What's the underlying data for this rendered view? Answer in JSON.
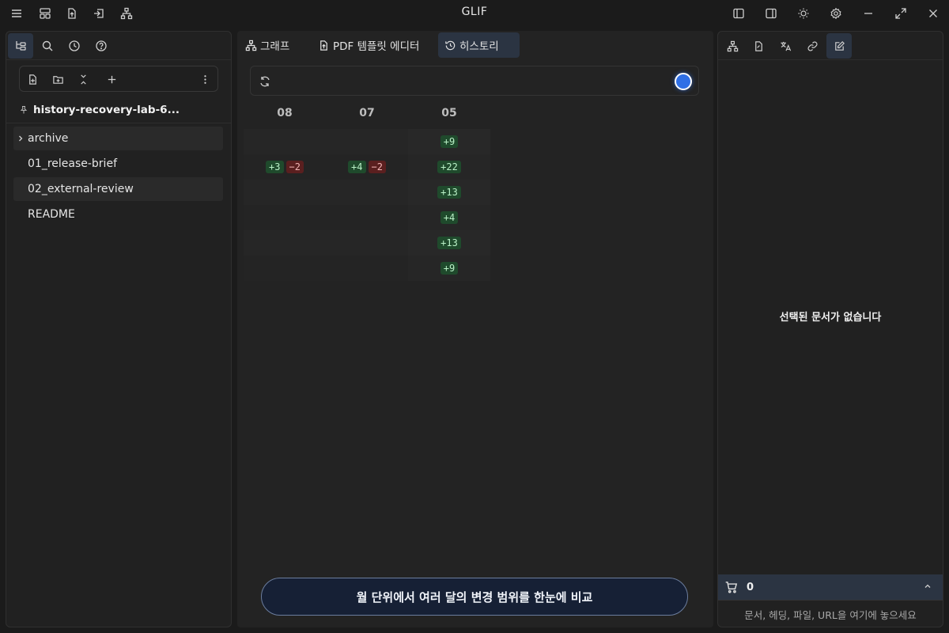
{
  "app": {
    "title": "GLIF"
  },
  "left_panel": {
    "vault_name": "history-recovery-lab-6...",
    "tree": [
      {
        "label": "archive",
        "type": "folder"
      },
      {
        "label": "01_release-brief",
        "type": "file"
      },
      {
        "label": "02_external-review",
        "type": "file"
      },
      {
        "label": "README",
        "type": "file"
      }
    ]
  },
  "main": {
    "tabs": [
      {
        "label": "그래프",
        "icon": "graph-icon"
      },
      {
        "label": "PDF 템플릿 에디터",
        "icon": "pdf-file-icon"
      },
      {
        "label": "히스토리",
        "icon": "history-icon",
        "active": true
      }
    ],
    "history": {
      "columns": [
        "08",
        "07",
        "05"
      ],
      "rows": [
        [
          [],
          [],
          [
            {
              "kind": "add",
              "text": "+9"
            }
          ]
        ],
        [
          [
            {
              "kind": "add",
              "text": "+3"
            },
            {
              "kind": "del",
              "text": "−2"
            }
          ],
          [
            {
              "kind": "add",
              "text": "+4"
            },
            {
              "kind": "del",
              "text": "−2"
            }
          ],
          [
            {
              "kind": "add",
              "text": "+22"
            }
          ]
        ],
        [
          [],
          [],
          [
            {
              "kind": "add",
              "text": "+13"
            }
          ]
        ],
        [
          [],
          [],
          [
            {
              "kind": "add",
              "text": "+4"
            }
          ]
        ],
        [
          [],
          [],
          [
            {
              "kind": "add",
              "text": "+13"
            }
          ]
        ],
        [
          [],
          [],
          [
            {
              "kind": "add",
              "text": "+9"
            }
          ]
        ]
      ]
    },
    "banner": "월 단위에서 여러 달의 변경 범위를 한눈에 비교"
  },
  "right_panel": {
    "empty_message": "선택된 문서가 없습니다",
    "cart_count": "0",
    "drop_hint": "문서, 헤딩, 파일, URL을 여기에 놓으세요"
  },
  "colors": {
    "accent": "#2f6fe6",
    "active_tab": "#2b3442",
    "add_badge": "#1f4a2c",
    "del_badge": "#5a1f1f"
  }
}
